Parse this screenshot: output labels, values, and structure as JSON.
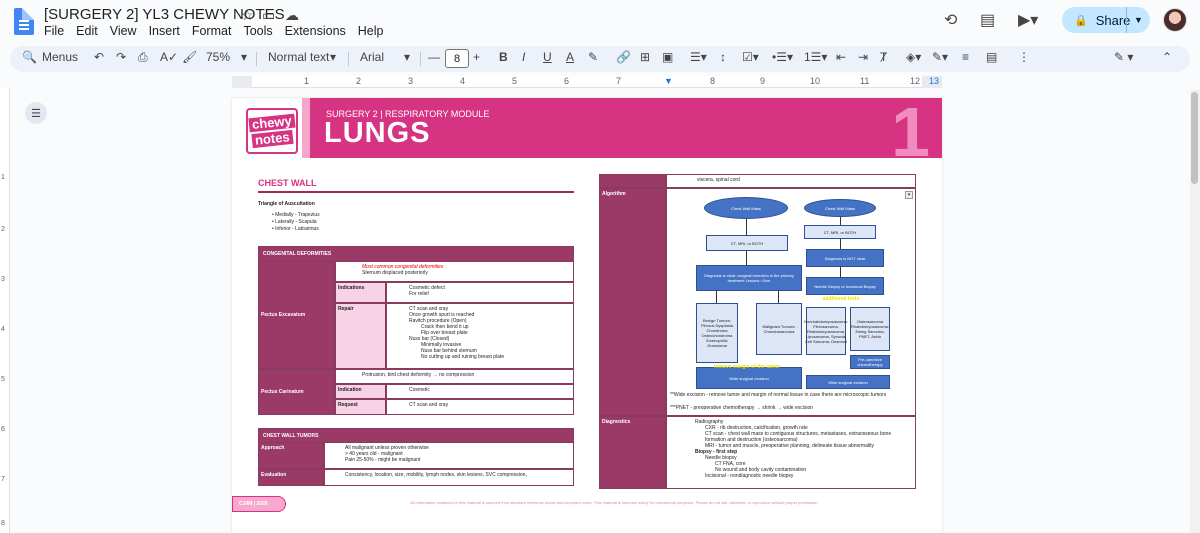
{
  "doc": {
    "title": "[SURGERY 2] YL3 CHEWY NOTES",
    "menu": [
      "File",
      "Edit",
      "View",
      "Insert",
      "Format",
      "Tools",
      "Extensions",
      "Help"
    ],
    "share_label": "Share",
    "accent": "#c2e7ff"
  },
  "toolbar": {
    "menus_label": "Menus",
    "zoom": "75%",
    "style": "Normal text",
    "font": "Arial",
    "font_size": "8"
  },
  "ruler_numbers": [
    "1",
    "2",
    "3",
    "4",
    "5",
    "6",
    "7",
    "8",
    "9",
    "10",
    "11",
    "12",
    "13"
  ],
  "vruler_numbers": [
    "1",
    "2",
    "3",
    "4",
    "5",
    "6",
    "7",
    "8"
  ],
  "page": {
    "banner_sub": "SURGERY 2 | RESPIRATORY MODULE",
    "banner_title": "LUNGS",
    "banner_num": "1",
    "logo_top": "chewy",
    "logo_bottom": "notes",
    "section": "CHEST WALL",
    "triangle_title": "Triangle of Auscultation",
    "triangle_items": [
      "Medially - Trapezius",
      "Laterally - Scapula",
      "Inferior - Latissimus"
    ],
    "congenital_header": "CONGENITAL DEFORMITIES",
    "pectus_excavatum": "Pectus Excavatum",
    "excavatum_notes": [
      "Most common congenital deformities",
      "Sternum displaced posteriorly"
    ],
    "indications_label": "Indications",
    "indications_items": [
      "Cosmetic defect",
      "For relief"
    ],
    "repair_label": "Repair",
    "repair_items": [
      "CT scan and xray",
      "Once growth spurt is reached",
      "Ravitch procedure (Open)",
      "Crack then bend it up",
      "Flip over breast plate",
      "Nuss bar (Closed)",
      "Minimally invasive",
      "Nuss bar behind sternum",
      "No cutting up and ruining breast plate"
    ],
    "pectus_carinatum": "Pectus Carinatum",
    "carinatum_note": "Protrusion, bird chest deformity → no compression",
    "indication_label": "Indication",
    "indication_value": "Cosmetic",
    "request_label": "Request",
    "request_value": "CT scan and xray",
    "tumors_header": "CHEST WALL TUMORS",
    "approach_label": "Approach",
    "approach_items": [
      "All malignant unless proven otherwise",
      "> 40 years old - malignant",
      "Pain 25-50% - might be malignant"
    ],
    "evaluation_label": "Evaluation",
    "evaluation_value": "Consistency, location, size, mobility, lymph nodes, skin lesions, SVC compression,",
    "right_top": "viscera, spinal cord",
    "algorithm_label": "Algorithm",
    "algo_boxes": {
      "mass1": "Chest Wall Mass",
      "mass2": "Chest Wall Mass",
      "ct1": "CT, MRI, or BOTH",
      "ct2": "CT, MRI, or BOTH",
      "dx_clear": "Diagnosis is clear; surgical resection is the primary treatment Lesions <2cm",
      "dx_not_clear": "Diagnosis is NOT clear",
      "biopsy": "Needle Biopsy or Incisional Biopsy",
      "benign": "Benign Tumors: Fibrous Dysplasia Chondroma Osteochondroma Eosinophilic Granuloma",
      "malignant": "Malignant Tumors: Chondrosarcoma",
      "softtissue": "Nonrhabdomyosarcoma: Fibrosarcoma, Rhabdomyosarcoma, Liposarcoma, Synovial Cell Sarcoma, Desmoid",
      "sarcoma": "Osteosarcoma Rhabdomyosarcoma: Ewing Sarcoma, PNET, Askin",
      "preop": "Pre-operative chemotherapy",
      "wide1": "Wide surgical excision",
      "wide2": "Wide surgical excision",
      "handwrite1": "remove margin of the tumor",
      "handwrite2": "additional tests"
    },
    "wide_excision_note": "**Wide excision - remove tumor and margin of normal tissue in case there are microscopic tumors",
    "pnet_note": "***PNET - preoperative chemotherapy → shrink → wide excision",
    "diagnostics_label": "Diagnostics",
    "diagnostics_items": [
      "Radiography",
      "CXR - rib destruction, calcification, growth rate",
      "CT scan - chest wall mass to contiguous structures, metastases, extraosseous bone formation and destruction (osteosarcoma)",
      "MRI - tumor and muscle, preoperative planning, delineate tissue abnormality",
      "Biopsy - first step",
      "Needle biopsy",
      "CT FNA, core",
      "No wound and body cavity contamination",
      "Incisional - nondiagnostic needle biopsy"
    ],
    "footer_tag": "CJ/IM | 2026",
    "disclaimer": "All information contained in this material is sourced from standard reference books and accepted notes. This material is intended solely for educational purposes. Please do not sell, distribute, or reproduce without proper permission.",
    "accent": "#d63383",
    "table_color": "#9b3a67"
  }
}
